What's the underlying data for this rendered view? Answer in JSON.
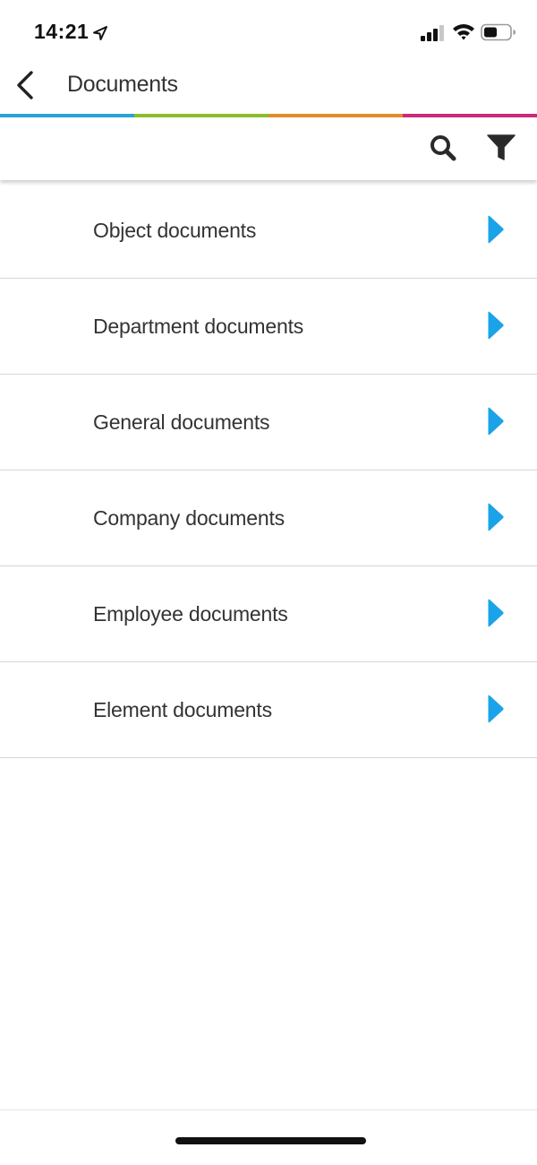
{
  "status_bar": {
    "time": "14:21",
    "icons": [
      "location-arrow-icon",
      "signal-icon",
      "wifi-icon",
      "battery-icon"
    ]
  },
  "header": {
    "back_icon": "chevron-left-icon",
    "title": "Documents"
  },
  "stripe_colors": [
    "#2aa3dc",
    "#8cbd2d",
    "#e38b2a",
    "#c92a7d"
  ],
  "toolbar": {
    "icons": [
      "search-icon",
      "filter-icon"
    ]
  },
  "documents": {
    "accent_color": "#1aa3e8",
    "items": [
      {
        "label": "Object documents"
      },
      {
        "label": "Department documents"
      },
      {
        "label": "General documents"
      },
      {
        "label": "Company documents"
      },
      {
        "label": "Employee documents"
      },
      {
        "label": "Element documents"
      }
    ]
  }
}
